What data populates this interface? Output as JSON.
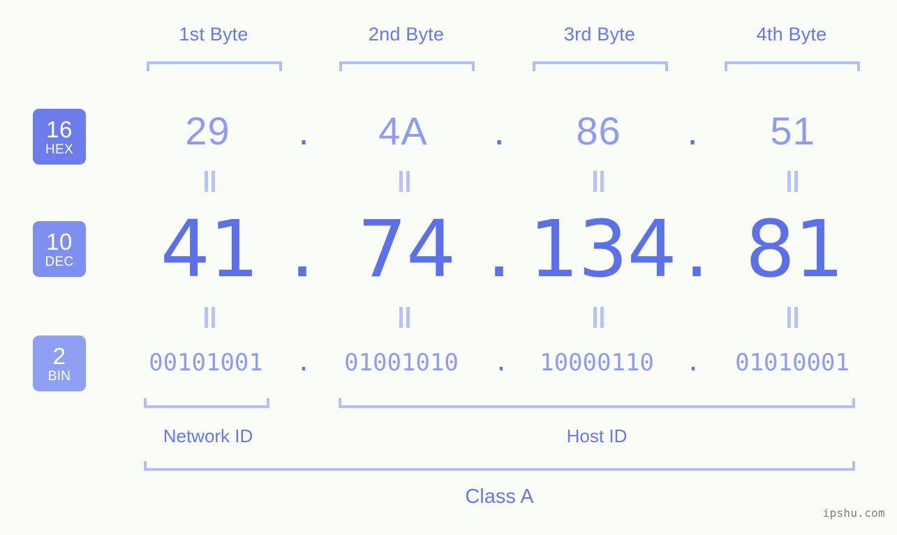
{
  "meta": {
    "background_color": "#fafcf7",
    "accent_color": "#5c70e8",
    "light_accent_color": "#8d9bf2",
    "bracket_color": "#b3bdf7",
    "label_color": "#6678ee"
  },
  "byte_headers": [
    {
      "label": "1st Byte"
    },
    {
      "label": "2nd Byte"
    },
    {
      "label": "3rd Byte"
    },
    {
      "label": "4th Byte"
    }
  ],
  "bases": [
    {
      "id": "hex",
      "number": "16",
      "abbr": "HEX",
      "badge_color": "#6c7ce8"
    },
    {
      "id": "dec",
      "number": "10",
      "abbr": "DEC",
      "badge_color": "#7f8ff0"
    },
    {
      "id": "bin",
      "number": "2",
      "abbr": "BIN",
      "badge_color": "#8fa0f4"
    }
  ],
  "separator": ".",
  "equals_glyph": "=",
  "rows": {
    "hex": {
      "octets": [
        "29",
        "4A",
        "86",
        "51"
      ]
    },
    "dec": {
      "octets": [
        "41",
        "74",
        "134",
        "81"
      ]
    },
    "bin": {
      "octets": [
        "00101001",
        "01001010",
        "10000110",
        "01010001"
      ]
    }
  },
  "segments": [
    {
      "id": "network",
      "label": "Network ID"
    },
    {
      "id": "host",
      "label": "Host ID"
    }
  ],
  "class": {
    "label": "Class A"
  },
  "watermark": {
    "text": "ipshu.com"
  }
}
